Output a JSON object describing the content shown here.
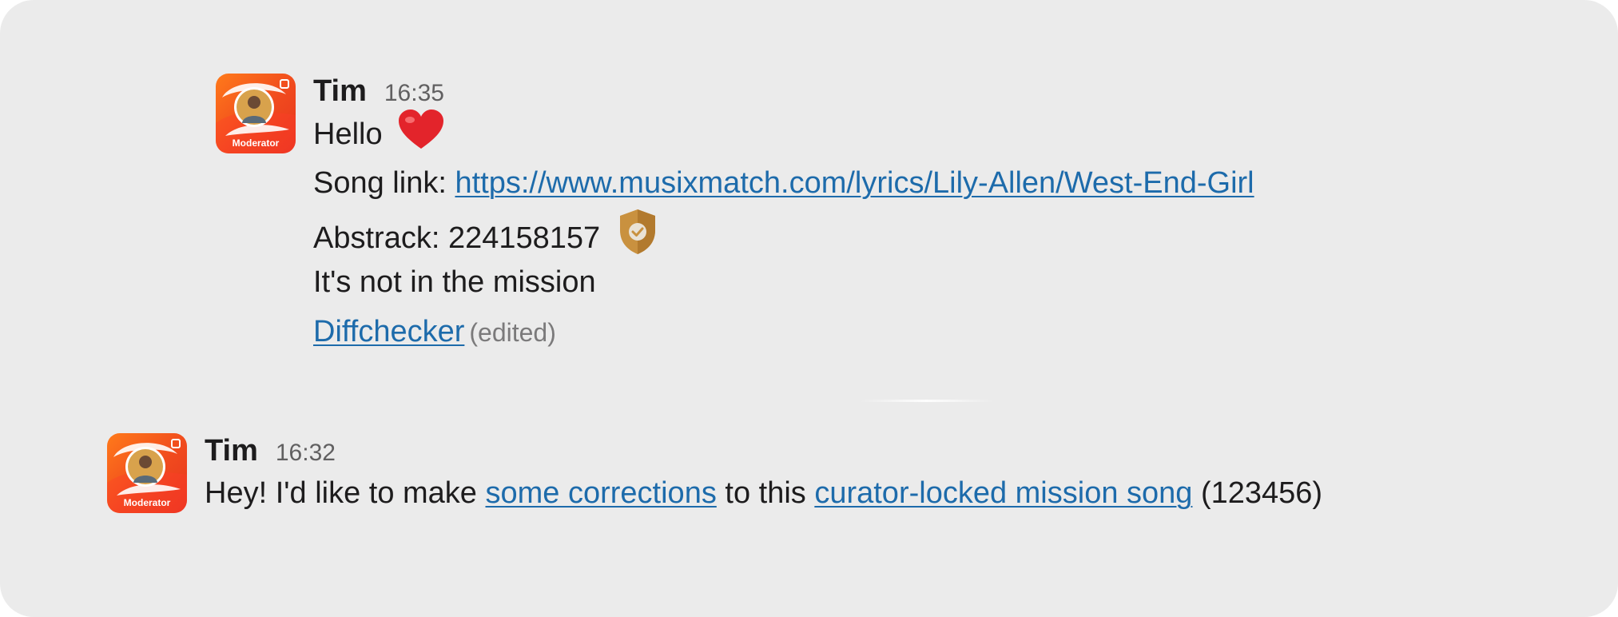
{
  "colors": {
    "panel_background": "#ebebeb",
    "link": "#1d6bab",
    "avatar_accent": "#f04a1e"
  },
  "messages": [
    {
      "author": "Tim",
      "time": "16:35",
      "avatar_badge": "Moderator",
      "greeting": "Hello",
      "greeting_emoji": "heart-icon",
      "song_link_label": "Song link: ",
      "song_link_url": "https://www.musixmatch.com/lyrics/Lily-Allen/West-End-Girl",
      "abstrack_label": "Abstrack: 224158157",
      "abstrack_icon": "verified-shield-icon",
      "note": "It's not in the mission",
      "diffchecker_link": "Diffchecker",
      "edited_label": "(edited)"
    },
    {
      "author": "Tim",
      "time": "16:32",
      "avatar_badge": "Moderator",
      "text_before": "Hey! I'd like to make ",
      "link_1": "some corrections",
      "text_middle": " to this ",
      "link_2": "curator-locked mission song",
      "text_after": " (123456)"
    }
  ]
}
